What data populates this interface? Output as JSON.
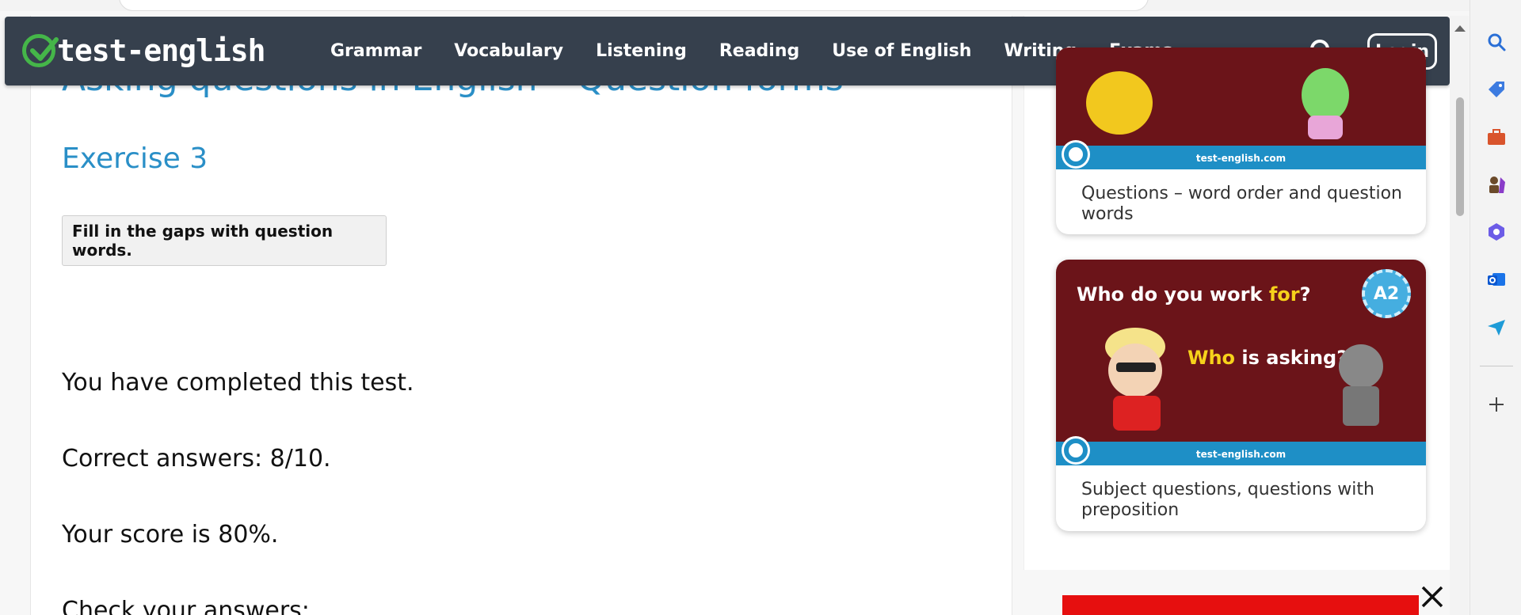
{
  "nav": {
    "logo_text": "test-english",
    "links": [
      "Grammar",
      "Vocabulary",
      "Listening",
      "Reading",
      "Use of English",
      "Writing",
      "Exams"
    ],
    "login_label": "Login"
  },
  "page": {
    "heading": "Asking questions in English – Question forms",
    "exercise_title": "Exercise 3",
    "instruction": "Fill in the gaps with question words.",
    "completed": "You have completed this test.",
    "correct": "Correct answers: 8/10.",
    "score": "Your score is 80%.",
    "check": "Check your answers:"
  },
  "sidebar": {
    "cards": [
      {
        "caption": "Questions – word order and question words",
        "site": "test-english.com"
      },
      {
        "caption": "Subject questions, questions with preposition",
        "site": "test-english.com",
        "img_line1_pre": "Who do you work ",
        "img_line1_hl": "for",
        "img_line1_post": "?",
        "img_line2_hl": "Who",
        "img_line2_post": " is asking?",
        "badge": "A2"
      }
    ]
  },
  "colors": {
    "nav_bg": "#36404d",
    "heading_blue": "#2a8fc7",
    "logo_green": "#45b649",
    "card_bg": "#6b1419",
    "card_stripe": "#1e8fc6",
    "ad_red": "#e60f0f"
  },
  "icons": {
    "search": "search-icon",
    "close": "close-icon",
    "edge_sidebar": [
      "search-icon",
      "tag-icon",
      "briefcase-icon",
      "chess-icon",
      "copilot-icon",
      "outlook-icon",
      "send-icon",
      "plus-icon"
    ]
  }
}
